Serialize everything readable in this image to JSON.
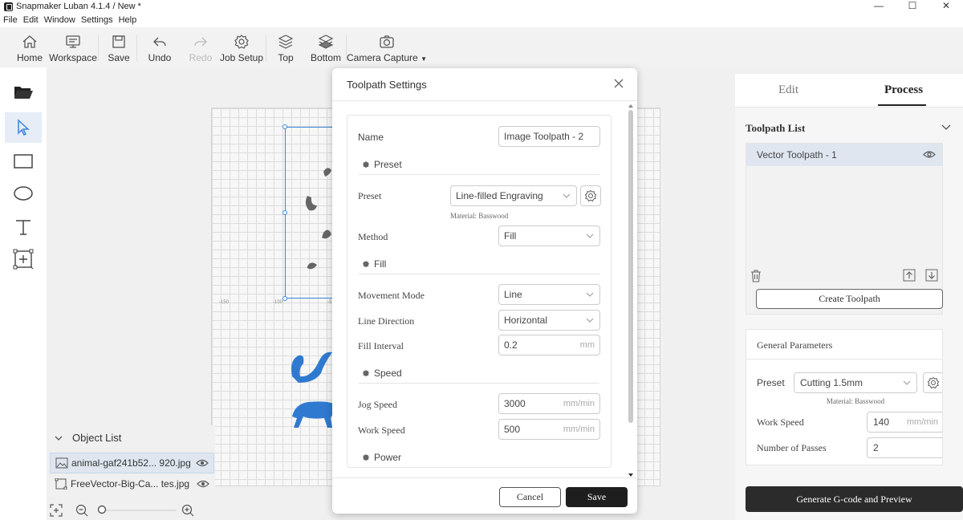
{
  "window": {
    "title": "Snapmaker Luban 4.1.4 / New *",
    "controls": [
      "—",
      "☐",
      "✕"
    ]
  },
  "menu": [
    "File",
    "Edit",
    "Window",
    "Settings",
    "Help"
  ],
  "toolbar": {
    "home": "Home",
    "workspace": "Workspace",
    "save": "Save",
    "undo": "Undo",
    "redo": "Redo",
    "job_setup": "Job Setup",
    "top": "Top",
    "bottom": "Bottom",
    "camera_capture": "Camera Capture"
  },
  "canvas": {
    "axis_labels": [
      "-150",
      "-100",
      "-5"
    ]
  },
  "object_list": {
    "title": "Object List",
    "items": [
      {
        "name": "animal-gaf241b52... 920.jpg",
        "selected": true
      },
      {
        "name": "FreeVector-Big-Ca... tes.jpg",
        "selected": false
      }
    ]
  },
  "right_panel": {
    "tabs": {
      "edit": "Edit",
      "process": "Process"
    },
    "toolpath_list": {
      "title": "Toolpath List",
      "items": [
        "Vector Toolpath - 1"
      ]
    },
    "create_toolpath": "Create Toolpath",
    "general_parameters": {
      "title": "General Parameters",
      "preset_label": "Preset",
      "preset_value": "Cutting 1.5mm",
      "material": "Material: Basswood",
      "work_speed_label": "Work Speed",
      "work_speed_value": "140",
      "work_speed_unit": "mm/min",
      "passes_label": "Number of Passes",
      "passes_value": "2"
    },
    "generate_button": "Generate G-code and Preview"
  },
  "modal": {
    "title": "Toolpath Settings",
    "name_label": "Name",
    "name_value": "Image Toolpath - 2",
    "section_preset": "Preset",
    "preset_label": "Preset",
    "preset_value": "Line-filled Engraving",
    "material": "Material: Basswood",
    "method_label": "Method",
    "method_value": "Fill",
    "section_fill": "Fill",
    "movement_label": "Movement Mode",
    "movement_value": "Line",
    "line_dir_label": "Line Direction",
    "line_dir_value": "Horizontal",
    "fill_interval_label": "Fill Interval",
    "fill_interval_value": "0.2",
    "fill_interval_unit": "mm",
    "section_speed": "Speed",
    "jog_label": "Jog Speed",
    "jog_value": "3000",
    "jog_unit": "mm/min",
    "work_label": "Work Speed",
    "work_value": "500",
    "work_unit": "mm/min",
    "section_power": "Power",
    "cancel": "Cancel",
    "save": "Save"
  },
  "colors": {
    "accent": "#3c86d8",
    "dark_button": "#1e1e1e",
    "selection": "#dfe6f0"
  }
}
